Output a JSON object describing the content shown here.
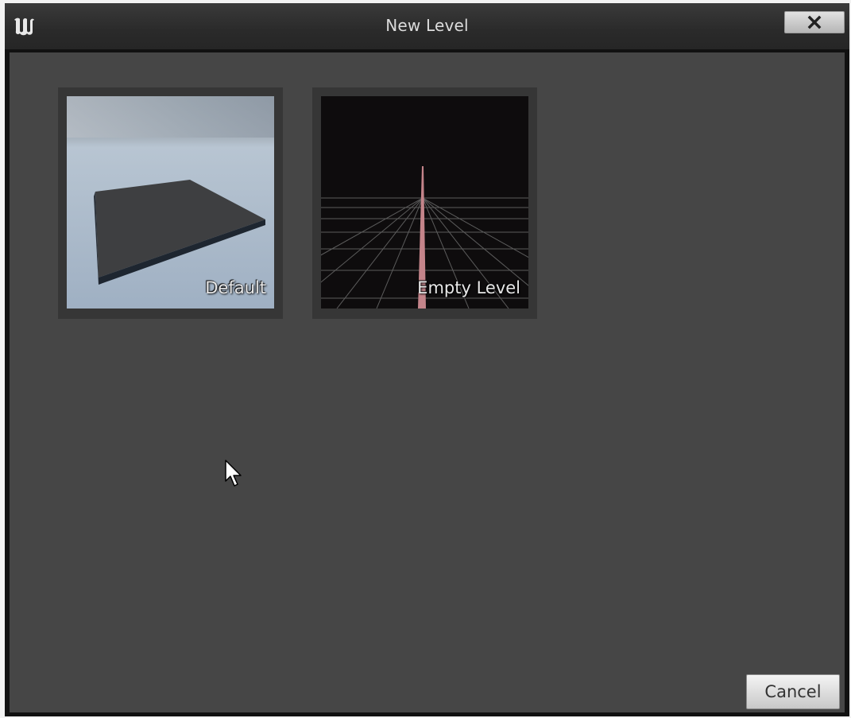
{
  "window": {
    "title": "New Level",
    "close_icon": "close-icon",
    "logo_icon": "unreal-logo-icon"
  },
  "templates": [
    {
      "label": "Default",
      "thumbnail": "default-level-thumbnail"
    },
    {
      "label": "Empty Level",
      "thumbnail": "empty-level-thumbnail"
    }
  ],
  "footer": {
    "cancel_label": "Cancel"
  },
  "colors": {
    "titlebar": "#2c2c2c",
    "panel": "#464646",
    "tile_frame": "#363636",
    "button": "#d8d8d8"
  }
}
